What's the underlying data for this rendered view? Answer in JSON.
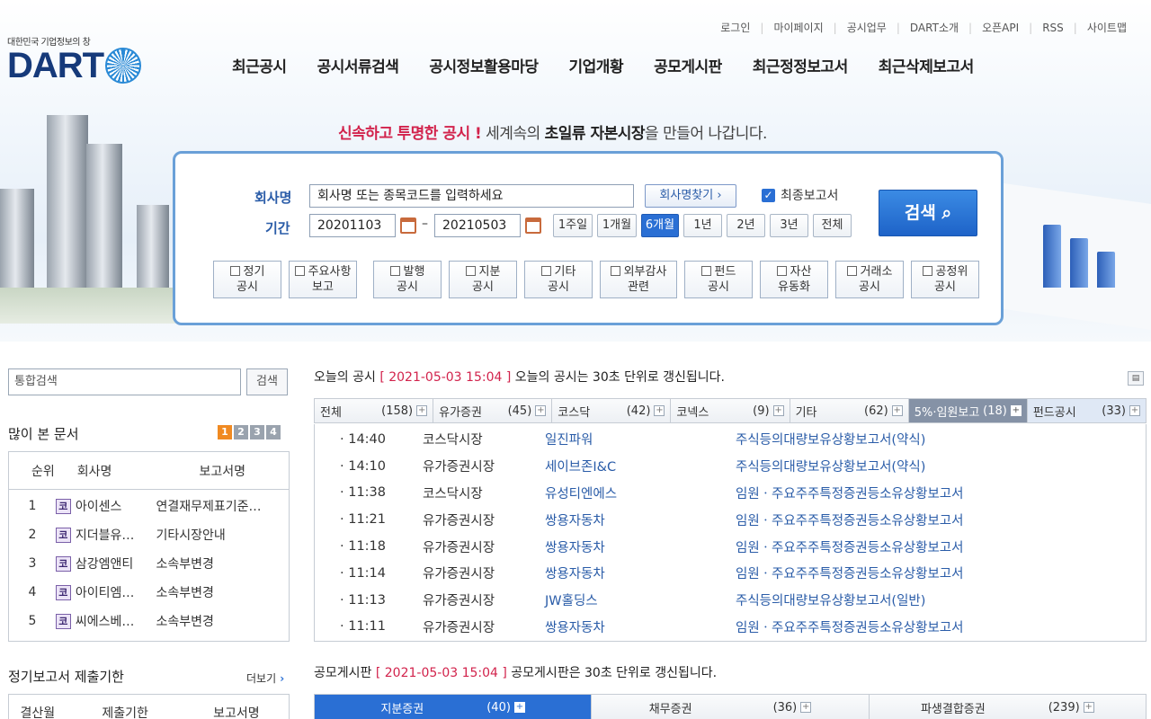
{
  "util_links": [
    "로그인",
    "마이페이지",
    "공시업무",
    "DART소개",
    "오픈API",
    "RSS",
    "사이트맵"
  ],
  "logo": {
    "tagline": "대한민국 기업정보의 창",
    "wordmark": "DART"
  },
  "gnb": [
    "최근공시",
    "공시서류검색",
    "공시정보활용마당",
    "기업개황",
    "공모게시판",
    "최근정정보고서",
    "최근삭제보고서"
  ],
  "slogan": {
    "p1": "신속하고",
    "p2": "투명한 공시 !",
    "p3": " 세계속의 ",
    "p4": "초일류",
    "p5": "  자본시장",
    "p6": "을 만들어 나갑니다."
  },
  "search": {
    "company_label": "회사명",
    "company_placeholder": "회사명 또는 종목코드를 입력하세요",
    "find_button": "회사명찾기 ›",
    "final_report_label": "최종보고서",
    "period_label": "기간",
    "date_from": "20201103",
    "date_to": "20210503",
    "dash": "–",
    "periods": [
      "1주일",
      "1개월",
      "6개월",
      "1년",
      "2년",
      "3년",
      "전체"
    ],
    "search_button": "검색",
    "categories": [
      [
        "정기",
        "공시"
      ],
      [
        "주요사항",
        "보고"
      ],
      [
        "발행",
        "공시"
      ],
      [
        "지분",
        "공시"
      ],
      [
        "기타",
        "공시"
      ],
      [
        "외부감사",
        "관련"
      ],
      [
        "펀드",
        "공시"
      ],
      [
        "자산",
        "유동화"
      ],
      [
        "거래소",
        "공시"
      ],
      [
        "공정위",
        "공시"
      ]
    ]
  },
  "left": {
    "search_placeholder": "통합검색",
    "search_button": "검색",
    "popular_title": "많이 본 문서",
    "pages": [
      "1",
      "2",
      "3",
      "4"
    ],
    "popular_headers": [
      "순위",
      "회사명",
      "보고서명"
    ],
    "popular": [
      {
        "rank": "1",
        "company": "아이센스",
        "report": "연결재무제표기준…"
      },
      {
        "rank": "2",
        "company": "지더블유…",
        "report": "기타시장안내"
      },
      {
        "rank": "3",
        "company": "삼강엠앤티",
        "report": "소속부변경"
      },
      {
        "rank": "4",
        "company": "아이티엠…",
        "report": "소속부변경"
      },
      {
        "rank": "5",
        "company": "씨에스베…",
        "report": "소속부변경"
      }
    ],
    "market_badge": "코",
    "deadline_title": "정기보고서 제출기한",
    "more": "더보기",
    "deadline_headers": [
      "결산월",
      "제출기한",
      "보고서명"
    ]
  },
  "today": {
    "title_pre": "오늘의 공시 ",
    "timestamp": "[ 2021-05-03 15:04 ]",
    "title_post": " 오늘의 공시는 30초 단위로 갱신됩니다.",
    "tabs": [
      {
        "name": "전체",
        "count": "(158)"
      },
      {
        "name": "유가증권",
        "count": "(45)"
      },
      {
        "name": "코스닥",
        "count": "(42)"
      },
      {
        "name": "코넥스",
        "count": "(9)"
      },
      {
        "name": "기타",
        "count": "(62)"
      },
      {
        "name": "5%·임원보고",
        "count": "(18)"
      },
      {
        "name": "펀드공시",
        "count": "(33)"
      }
    ],
    "rows": [
      {
        "time": "14:40",
        "market": "코스닥시장",
        "company": "일진파워",
        "report": "주식등의대량보유상황보고서(약식)"
      },
      {
        "time": "14:10",
        "market": "유가증권시장",
        "company": "세이브존I&C",
        "report": "주식등의대량보유상황보고서(약식)"
      },
      {
        "time": "11:38",
        "market": "코스닥시장",
        "company": "유성티엔에스",
        "report": "임원ㆍ주요주주특정증권등소유상황보고서"
      },
      {
        "time": "11:21",
        "market": "유가증권시장",
        "company": "쌍용자동차",
        "report": "임원ㆍ주요주주특정증권등소유상황보고서"
      },
      {
        "time": "11:18",
        "market": "유가증권시장",
        "company": "쌍용자동차",
        "report": "임원ㆍ주요주주특정증권등소유상황보고서"
      },
      {
        "time": "11:14",
        "market": "유가증권시장",
        "company": "쌍용자동차",
        "report": "임원ㆍ주요주주특정증권등소유상황보고서"
      },
      {
        "time": "11:13",
        "market": "유가증권시장",
        "company": "JW홀딩스",
        "report": "주식등의대량보유상황보고서(일반)"
      },
      {
        "time": "11:11",
        "market": "유가증권시장",
        "company": "쌍용자동차",
        "report": "임원ㆍ주요주주특정증권등소유상황보고서"
      }
    ]
  },
  "offering": {
    "title_pre": "공모게시판 ",
    "timestamp": "[ 2021-05-03 15:04 ]",
    "title_post": " 공모게시판은 30초 단위로 갱신됩니다.",
    "tabs": [
      {
        "name": "지분증권",
        "count": "(40)"
      },
      {
        "name": "채무증권",
        "count": "(36)"
      },
      {
        "name": "파생결합증권",
        "count": "(239)"
      }
    ]
  },
  "colors": {
    "accent": "#2a6fd4",
    "brand_navy": "#163a7a",
    "highlight_red": "#d2234c"
  }
}
